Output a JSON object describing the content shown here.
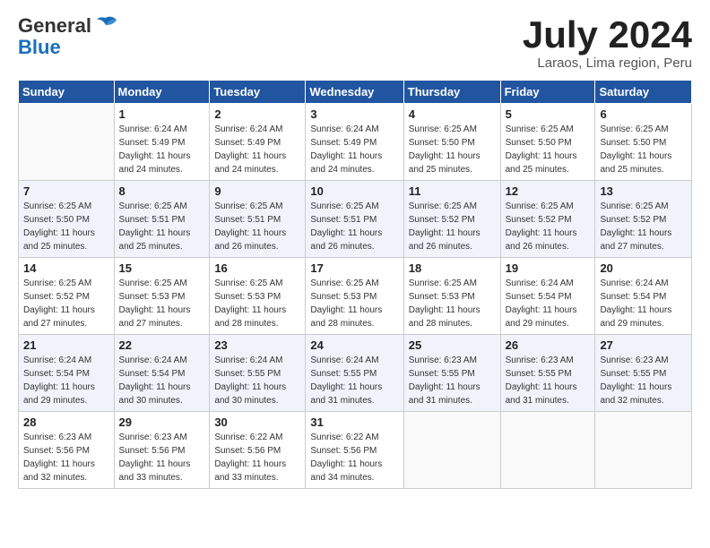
{
  "logo": {
    "general": "General",
    "blue": "Blue"
  },
  "title": "July 2024",
  "location": "Laraos, Lima region, Peru",
  "header_days": [
    "Sunday",
    "Monday",
    "Tuesday",
    "Wednesday",
    "Thursday",
    "Friday",
    "Saturday"
  ],
  "weeks": [
    [
      {
        "day": "",
        "sunrise": "",
        "sunset": "",
        "daylight": ""
      },
      {
        "day": "1",
        "sunrise": "6:24 AM",
        "sunset": "5:49 PM",
        "daylight": "11 hours and 24 minutes."
      },
      {
        "day": "2",
        "sunrise": "6:24 AM",
        "sunset": "5:49 PM",
        "daylight": "11 hours and 24 minutes."
      },
      {
        "day": "3",
        "sunrise": "6:24 AM",
        "sunset": "5:49 PM",
        "daylight": "11 hours and 24 minutes."
      },
      {
        "day": "4",
        "sunrise": "6:25 AM",
        "sunset": "5:50 PM",
        "daylight": "11 hours and 25 minutes."
      },
      {
        "day": "5",
        "sunrise": "6:25 AM",
        "sunset": "5:50 PM",
        "daylight": "11 hours and 25 minutes."
      },
      {
        "day": "6",
        "sunrise": "6:25 AM",
        "sunset": "5:50 PM",
        "daylight": "11 hours and 25 minutes."
      }
    ],
    [
      {
        "day": "7",
        "sunrise": "6:25 AM",
        "sunset": "5:50 PM",
        "daylight": "11 hours and 25 minutes."
      },
      {
        "day": "8",
        "sunrise": "6:25 AM",
        "sunset": "5:51 PM",
        "daylight": "11 hours and 25 minutes."
      },
      {
        "day": "9",
        "sunrise": "6:25 AM",
        "sunset": "5:51 PM",
        "daylight": "11 hours and 26 minutes."
      },
      {
        "day": "10",
        "sunrise": "6:25 AM",
        "sunset": "5:51 PM",
        "daylight": "11 hours and 26 minutes."
      },
      {
        "day": "11",
        "sunrise": "6:25 AM",
        "sunset": "5:52 PM",
        "daylight": "11 hours and 26 minutes."
      },
      {
        "day": "12",
        "sunrise": "6:25 AM",
        "sunset": "5:52 PM",
        "daylight": "11 hours and 26 minutes."
      },
      {
        "day": "13",
        "sunrise": "6:25 AM",
        "sunset": "5:52 PM",
        "daylight": "11 hours and 27 minutes."
      }
    ],
    [
      {
        "day": "14",
        "sunrise": "6:25 AM",
        "sunset": "5:52 PM",
        "daylight": "11 hours and 27 minutes."
      },
      {
        "day": "15",
        "sunrise": "6:25 AM",
        "sunset": "5:53 PM",
        "daylight": "11 hours and 27 minutes."
      },
      {
        "day": "16",
        "sunrise": "6:25 AM",
        "sunset": "5:53 PM",
        "daylight": "11 hours and 28 minutes."
      },
      {
        "day": "17",
        "sunrise": "6:25 AM",
        "sunset": "5:53 PM",
        "daylight": "11 hours and 28 minutes."
      },
      {
        "day": "18",
        "sunrise": "6:25 AM",
        "sunset": "5:53 PM",
        "daylight": "11 hours and 28 minutes."
      },
      {
        "day": "19",
        "sunrise": "6:24 AM",
        "sunset": "5:54 PM",
        "daylight": "11 hours and 29 minutes."
      },
      {
        "day": "20",
        "sunrise": "6:24 AM",
        "sunset": "5:54 PM",
        "daylight": "11 hours and 29 minutes."
      }
    ],
    [
      {
        "day": "21",
        "sunrise": "6:24 AM",
        "sunset": "5:54 PM",
        "daylight": "11 hours and 29 minutes."
      },
      {
        "day": "22",
        "sunrise": "6:24 AM",
        "sunset": "5:54 PM",
        "daylight": "11 hours and 30 minutes."
      },
      {
        "day": "23",
        "sunrise": "6:24 AM",
        "sunset": "5:55 PM",
        "daylight": "11 hours and 30 minutes."
      },
      {
        "day": "24",
        "sunrise": "6:24 AM",
        "sunset": "5:55 PM",
        "daylight": "11 hours and 31 minutes."
      },
      {
        "day": "25",
        "sunrise": "6:23 AM",
        "sunset": "5:55 PM",
        "daylight": "11 hours and 31 minutes."
      },
      {
        "day": "26",
        "sunrise": "6:23 AM",
        "sunset": "5:55 PM",
        "daylight": "11 hours and 31 minutes."
      },
      {
        "day": "27",
        "sunrise": "6:23 AM",
        "sunset": "5:55 PM",
        "daylight": "11 hours and 32 minutes."
      }
    ],
    [
      {
        "day": "28",
        "sunrise": "6:23 AM",
        "sunset": "5:56 PM",
        "daylight": "11 hours and 32 minutes."
      },
      {
        "day": "29",
        "sunrise": "6:23 AM",
        "sunset": "5:56 PM",
        "daylight": "11 hours and 33 minutes."
      },
      {
        "day": "30",
        "sunrise": "6:22 AM",
        "sunset": "5:56 PM",
        "daylight": "11 hours and 33 minutes."
      },
      {
        "day": "31",
        "sunrise": "6:22 AM",
        "sunset": "5:56 PM",
        "daylight": "11 hours and 34 minutes."
      },
      {
        "day": "",
        "sunrise": "",
        "sunset": "",
        "daylight": ""
      },
      {
        "day": "",
        "sunrise": "",
        "sunset": "",
        "daylight": ""
      },
      {
        "day": "",
        "sunrise": "",
        "sunset": "",
        "daylight": ""
      }
    ]
  ]
}
